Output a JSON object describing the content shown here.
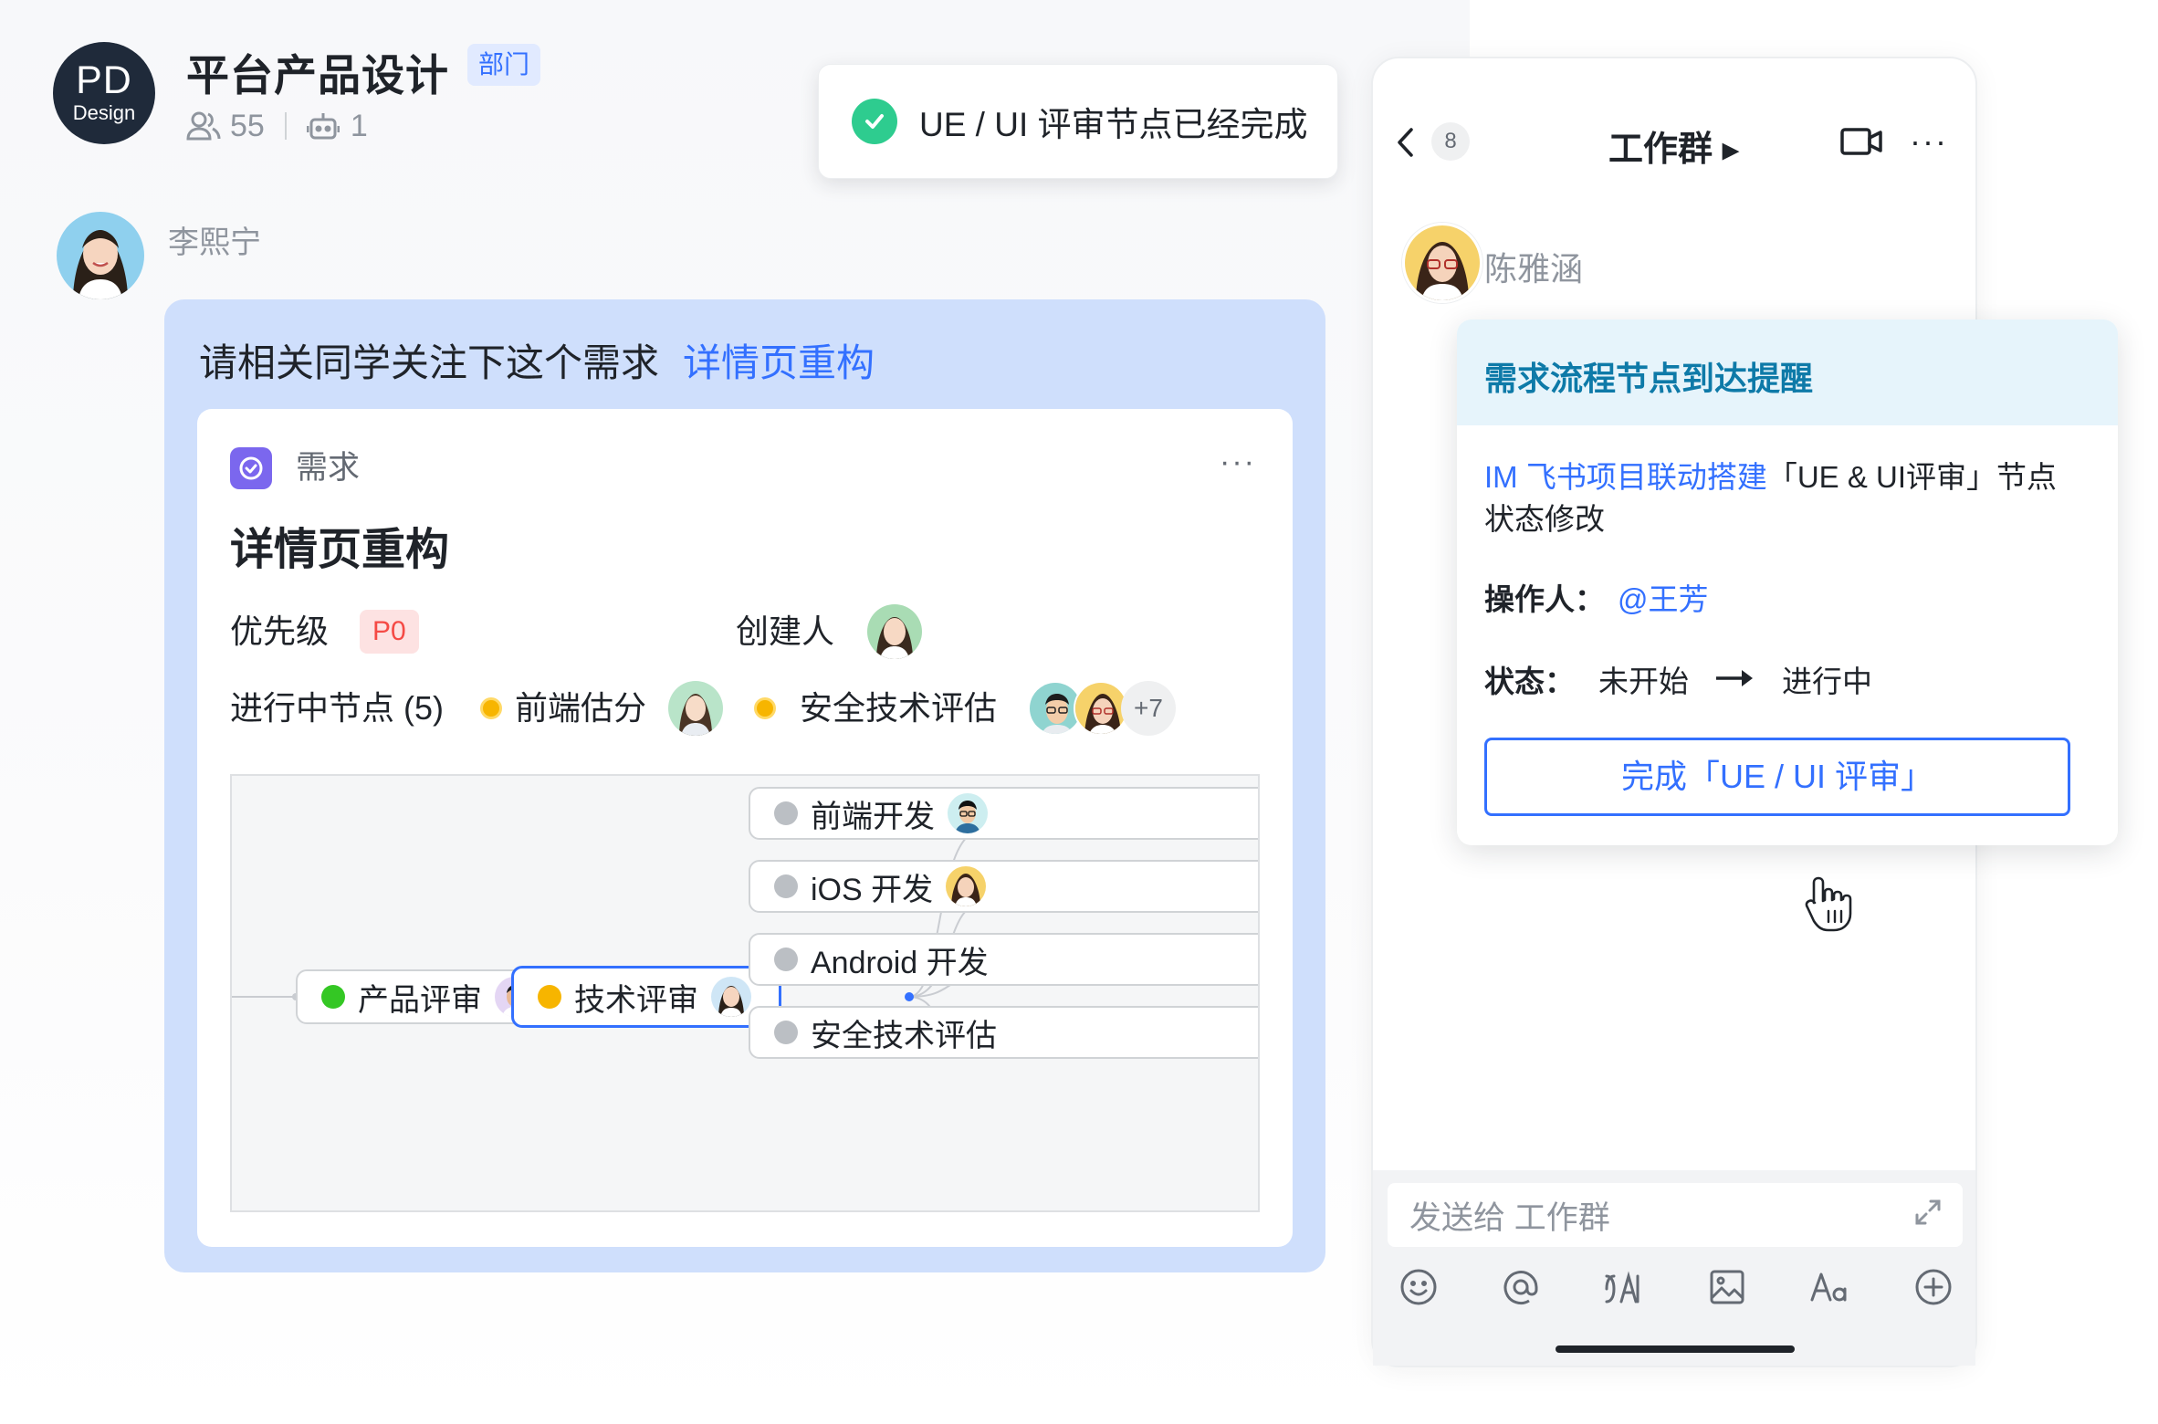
{
  "group": {
    "avatar_line1": "PD",
    "avatar_line2": "Design",
    "name": "平台产品设计",
    "badge": "部门",
    "member_count": "55",
    "bot_count": "1"
  },
  "message": {
    "sender": "李熙宁",
    "text": "请相关同学关注下这个需求",
    "link": "详情页重构",
    "card": {
      "type_label": "需求",
      "more": "···",
      "title": "详情页重构",
      "priority_label": "优先级",
      "priority_value": "P0",
      "creator_label": "创建人",
      "in_progress_label": "进行中节点 (5)",
      "node_a": "前端估分",
      "node_b": "安全技术评估",
      "more_people": "+7"
    }
  },
  "flow": {
    "nodes": [
      {
        "label": "产品评审",
        "status": "done"
      },
      {
        "label": "技术评审",
        "status": "in-progress"
      },
      {
        "label": "前端开发",
        "status": "not-started"
      },
      {
        "label": "iOS 开发",
        "status": "not-started"
      },
      {
        "label": "Android 开发",
        "status": "not-started"
      },
      {
        "label": "安全技术评估",
        "status": "not-started"
      }
    ]
  },
  "toast": {
    "text": "UE / UI 评审节点已经完成"
  },
  "chat": {
    "unread": "8",
    "title": "工作群 ▸",
    "more": "···",
    "sender": "陈雅涵",
    "input_placeholder": "发送给 工作群",
    "tools": [
      "emoji-icon",
      "mention-icon",
      "translate-icon",
      "image-icon",
      "font-icon",
      "add-icon"
    ]
  },
  "notification": {
    "title": "需求流程节点到达提醒",
    "project_link": "IM 飞书项目联动搭建",
    "body_1": "「UE & UI评审」节点",
    "body_2": "状态修改",
    "operator_label": "操作人：",
    "operator": "@王芳",
    "status_label": "状态：",
    "status_from": "未开始",
    "status_to": "进行中",
    "button": "完成「UE / UI  评审」"
  },
  "colors": {
    "accent": "#3370ff",
    "bubble": "#cfdffc",
    "success": "#2ecc8f",
    "warning": "#f7b500",
    "danger": "#f54a45"
  }
}
